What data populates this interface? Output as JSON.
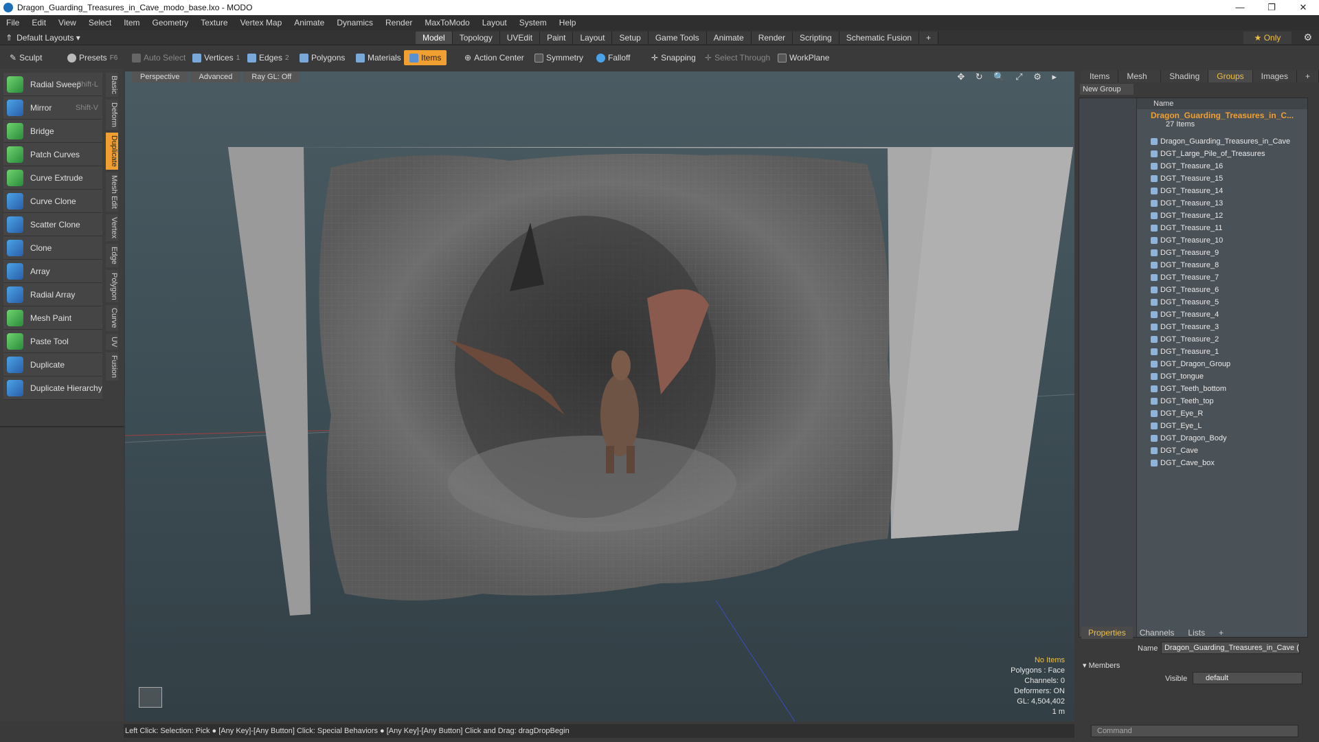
{
  "window": {
    "title": "Dragon_Guarding_Treasures_in_Cave_modo_base.lxo - MODO",
    "min": "—",
    "restore": "❐",
    "close": "✕"
  },
  "menu": [
    "File",
    "Edit",
    "View",
    "Select",
    "Item",
    "Geometry",
    "Texture",
    "Vertex Map",
    "Animate",
    "Dynamics",
    "Render",
    "MaxToModo",
    "Layout",
    "System",
    "Help"
  ],
  "layout": {
    "selector": "Default Layouts ▾",
    "tabs": [
      "Model",
      "Topology",
      "UVEdit",
      "Paint",
      "Layout",
      "Setup",
      "Game Tools",
      "Animate",
      "Render",
      "Scripting",
      "Schematic Fusion",
      "+"
    ],
    "active_tab": "Model",
    "only": "★  Only"
  },
  "toolbar": {
    "sculpt": "Sculpt",
    "presets": "Presets",
    "presets_key": "F6",
    "auto_select": "Auto Select",
    "vertices": "Vertices",
    "vertices_num": "1",
    "edges": "Edges",
    "edges_num": "2",
    "polygons": "Polygons",
    "materials": "Materials",
    "items": "Items",
    "action_center": "Action Center",
    "symmetry": "Symmetry",
    "falloff": "Falloff",
    "snapping": "Snapping",
    "select_through": "Select Through",
    "workplane": "WorkPlane"
  },
  "tools": [
    {
      "label": "Radial Sweep",
      "shortcut": "Shift-L"
    },
    {
      "label": "Mirror",
      "shortcut": "Shift-V"
    },
    {
      "label": "Bridge",
      "shortcut": ""
    },
    {
      "label": "Patch Curves",
      "shortcut": ""
    },
    {
      "label": "Curve Extrude",
      "shortcut": ""
    },
    {
      "label": "Curve Clone",
      "shortcut": ""
    },
    {
      "label": "Scatter Clone",
      "shortcut": ""
    },
    {
      "label": "Clone",
      "shortcut": ""
    },
    {
      "label": "Array",
      "shortcut": ""
    },
    {
      "label": "Radial Array",
      "shortcut": ""
    },
    {
      "label": "Mesh Paint",
      "shortcut": ""
    },
    {
      "label": "Paste Tool",
      "shortcut": ""
    },
    {
      "label": "Duplicate",
      "shortcut": ""
    },
    {
      "label": "Duplicate Hierarchy",
      "shortcut": ""
    }
  ],
  "vtabs": [
    "Basic",
    "Deform",
    "Duplicate",
    "Mesh Edit",
    "Vertex",
    "Edge",
    "Polygon",
    "Curve",
    "UV",
    "Fusion"
  ],
  "vtab_active": "Duplicate",
  "viewport": {
    "tabs": [
      "Perspective",
      "Advanced",
      "Ray GL: Off"
    ],
    "icons": "✥ ↻ 🔍 ⤢ ⚙ ▸",
    "info": {
      "no_items": "No Items",
      "polygons": "Polygons : Face",
      "channels": "Channels: 0",
      "deformers": "Deformers: ON",
      "gl": "GL: 4,504,402",
      "scale": "1 m"
    }
  },
  "status": "Left Click: Selection: Pick ● [Any Key]-[Any Button] Click: Special Behaviors ● [Any Key]-[Any Button] Click and Drag: dragDropBegin",
  "right_panel": {
    "tabs": [
      "Items",
      "Mesh ...",
      "Shading",
      "Groups",
      "Images",
      "+"
    ],
    "active_tab": "Groups",
    "new_group": "New Group",
    "tree_header": "Name",
    "group_title": "Dragon_Guarding_Treasures_in_C...",
    "group_count": "27 Items",
    "rows": [
      "Dragon_Guarding_Treasures_in_Cave",
      "DGT_Large_Pile_of_Treasures",
      "DGT_Treasure_16",
      "DGT_Treasure_15",
      "DGT_Treasure_14",
      "DGT_Treasure_13",
      "DGT_Treasure_12",
      "DGT_Treasure_11",
      "DGT_Treasure_10",
      "DGT_Treasure_9",
      "DGT_Treasure_8",
      "DGT_Treasure_7",
      "DGT_Treasure_6",
      "DGT_Treasure_5",
      "DGT_Treasure_4",
      "DGT_Treasure_3",
      "DGT_Treasure_2",
      "DGT_Treasure_1",
      "DGT_Dragon_Group",
      "DGT_tongue",
      "DGT_Teeth_bottom",
      "DGT_Teeth_top",
      "DGT_Eye_R",
      "DGT_Eye_L",
      "DGT_Dragon_Body",
      "DGT_Cave",
      "DGT_Cave_box"
    ],
    "props_tabs": [
      "Properties",
      "Channels",
      "Lists",
      "+"
    ],
    "props_active": "Properties",
    "name_label": "Name",
    "name_value": "Dragon_Guarding_Treasures_in_Cave (",
    "members": "▾ Members",
    "visible_label": "Visible",
    "visible_value": "default",
    "command_placeholder": "Command"
  }
}
